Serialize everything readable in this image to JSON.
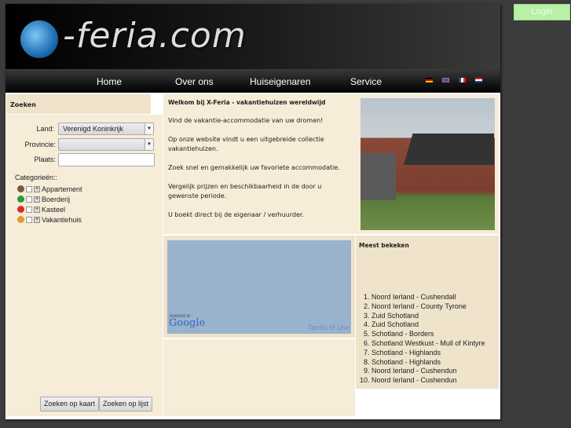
{
  "header": {
    "logo_text": "-feria.com",
    "login_label": "Login"
  },
  "nav": {
    "items": [
      "Home",
      "Over ons",
      "Huiseigenaren",
      "Service"
    ],
    "flags": [
      "de",
      "en",
      "fr",
      "nl"
    ]
  },
  "search": {
    "title": "Zoeken",
    "land_label": "Land:",
    "land_value": "Verenigd Koninkrijk",
    "provincie_label": "Provincie:",
    "provincie_value": "",
    "plaats_label": "Plaats:",
    "plaats_value": "",
    "categories_label": "Categorieën::",
    "categories": [
      {
        "label": "Appartement",
        "color": "#7a5a3a"
      },
      {
        "label": "Boerderij",
        "color": "#2e9a3a"
      },
      {
        "label": "Kasteel",
        "color": "#d83020"
      },
      {
        "label": "Vakantiehuis",
        "color": "#e09a30"
      }
    ],
    "map_button": "Zoeken op kaart",
    "list_button": "Zoeken op lijst"
  },
  "welcome": {
    "title": "Welkom bij X-Feria - vakantiehuizen wereldwijd",
    "paragraphs": [
      "Vind de vakantie-accommodatie van uw dromen!",
      "Op onze website vindt u een uitgebreide collectie vakantiehuizen.",
      "Zoek snel en gemakkelijk uw favoriete accommodatie.",
      "Vergelijk prijzen en beschikbaarheid in de door u gewenste periode.",
      "U boekt direct bij de eigenaar / verhuurder."
    ]
  },
  "map": {
    "powered_by": "POWERED BY",
    "brand": "Google",
    "terms": "Terms of Use"
  },
  "popular": {
    "title": "Meest bekeken",
    "items": [
      "Noord Ierland - Cushendall",
      "Noord Ierland - County Tyrone",
      "Zuid Schotland",
      "Zuid Schotland",
      "Schotland - Borders",
      "Schotland Westkust - Mull of Kintyre",
      "Schotland - Highlands",
      "Schotland - Highlands",
      "Noord Ierland - Cushendun",
      "Noord Ierland - Cushendun"
    ]
  }
}
